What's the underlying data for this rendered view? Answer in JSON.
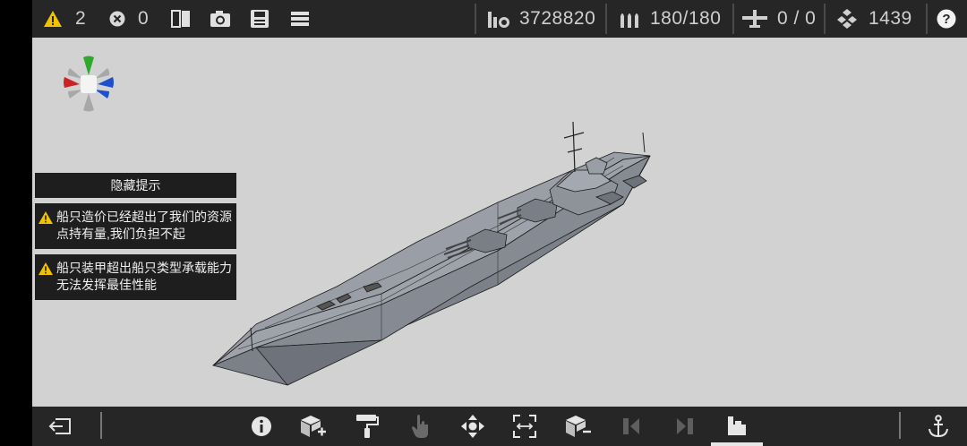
{
  "topbar": {
    "warnings": "2",
    "errors": "0",
    "cost": "3728820",
    "ammo": "180/180",
    "aircraft": "0 / 0",
    "resources": "1439"
  },
  "hints": {
    "hide": "隐藏提示",
    "warning1": "船只造价已经超出了我们的资源点持有量,我们负担不起",
    "warning2": "船只装甲超出船只类型承载能力无法发挥最佳性能"
  },
  "icons": {
    "top": [
      "warning-icon",
      "error-icon",
      "split-view-icon",
      "screenshot-icon",
      "save-icon",
      "menu-icon",
      "coins-icon",
      "ammo-icon",
      "aircraft-icon",
      "resources-icon",
      "help-icon"
    ],
    "bottom": [
      "exit-icon",
      "info-icon",
      "add-block-icon",
      "paint-roller-icon",
      "hand-pointer-icon",
      "move-icon",
      "resize-icon",
      "remove-block-icon",
      "previous-icon",
      "next-icon",
      "ship-silhouette-icon",
      "anchor-icon"
    ]
  },
  "colors": {
    "bar": "#262626",
    "viewport": "#d2d2d2",
    "warning": "#f2c200",
    "hull": "#8a8e96"
  }
}
